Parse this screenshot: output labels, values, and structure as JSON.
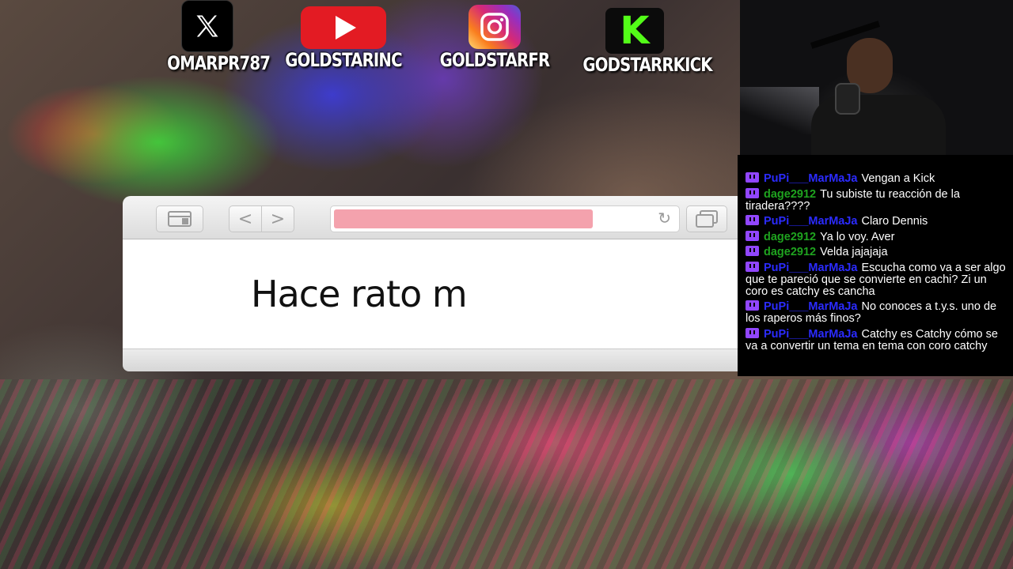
{
  "socials": [
    {
      "platform": "x",
      "icon": "x-logo-icon",
      "handle": "OMARPR787"
    },
    {
      "platform": "youtube",
      "icon": "youtube-logo-icon",
      "handle": "GOLDSTARINC"
    },
    {
      "platform": "instagram",
      "icon": "instagram-logo-icon",
      "handle": "GOLDSTARFR"
    },
    {
      "platform": "kick",
      "icon": "kick-logo-icon",
      "handle": "GODSTARRKICK",
      "logo_letter": "K"
    }
  ],
  "browser": {
    "typed_text": "Hace rato m",
    "address_progress": 0.76,
    "progress_color": "#f4a2ad",
    "back_glyph": "<",
    "forward_glyph": ">",
    "reload_glyph": "↻"
  },
  "chat": {
    "platform_icon": "twitch-icon",
    "messages": [
      {
        "user": "PuPi___MarMaJa",
        "user_color": "#2b2bff",
        "text": "Vengan a Kick"
      },
      {
        "user": "dage2912",
        "user_color": "#1fa31f",
        "text": "Tu subiste tu reacción de la tiradera????"
      },
      {
        "user": "PuPi___MarMaJa",
        "user_color": "#2b2bff",
        "text": "Claro Dennis"
      },
      {
        "user": "dage2912",
        "user_color": "#1fa31f",
        "text": "Ya lo voy. Aver"
      },
      {
        "user": "dage2912",
        "user_color": "#1fa31f",
        "text": "Velda jajajaja"
      },
      {
        "user": "PuPi___MarMaJa",
        "user_color": "#2b2bff",
        "text": "Escucha como va a ser algo que te pareció que se convierte en cachi? Zi un coro es catchy es cancha"
      },
      {
        "user": "PuPi___MarMaJa",
        "user_color": "#2b2bff",
        "text": "No conoces a t.y.s. uno de los raperos más finos?"
      },
      {
        "user": "PuPi___MarMaJa",
        "user_color": "#2b2bff",
        "text": "Catchy es Catchy cómo se va a convertir un tema en tema con coro catchy"
      }
    ]
  }
}
